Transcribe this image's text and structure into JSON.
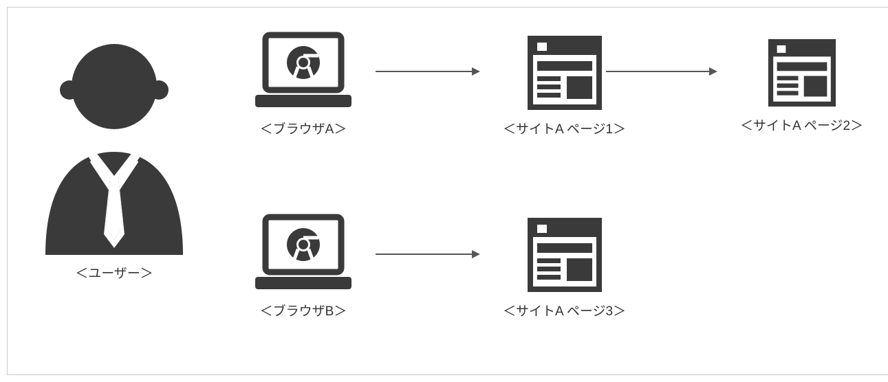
{
  "user": {
    "label": "＜ユーザー＞"
  },
  "browser_a": {
    "label": "＜ブラウザA＞"
  },
  "browser_b": {
    "label": "＜ブラウザB＞"
  },
  "site_a_page1": {
    "label": "＜サイトA ページ1＞"
  },
  "site_a_page2": {
    "label": "＜サイトA ページ2＞"
  },
  "site_a_page3": {
    "label": "＜サイトA ページ3＞"
  },
  "colors": {
    "icon": "#3a3a3a",
    "arrow": "#555555"
  }
}
